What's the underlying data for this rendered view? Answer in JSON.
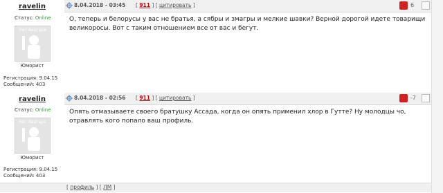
{
  "posts": [
    {
      "username": "ravelin",
      "status_label": "Статус:",
      "status_value": "Online",
      "avatar_text": "Нет Аватара",
      "rank": "Юморист",
      "registration": "Регистрация: 9.04.15",
      "messages": "Сообщений: 403",
      "date": "8.04.2018 - 03:45",
      "post_number": "911",
      "quote_label": "цитировать",
      "rating": "6",
      "text": "О, теперь и белорусы у вас не братья, а сябры и змагры и мелкие шавки? Верной дорогой идете товарищи великоросы. Вот с таким отношением все от вас и бегут."
    },
    {
      "username": "ravelin",
      "status_label": "Статус:",
      "status_value": "Online",
      "avatar_text": "Нет Аватара",
      "rank": "Юморист",
      "registration": "Регистрация: 9.04.15",
      "messages": "Сообщений: 403",
      "date": "8.04.2018 - 02:56",
      "post_number": "911",
      "quote_label": "цитировать",
      "rating": "-7",
      "text": "Опять отмазываете своего братушку Ассада, когда он опять применил хлор в Гутте? Ну молодцы чо, отравлять кого попало ваш профиль."
    }
  ],
  "footer": {
    "profile_label": "профиль",
    "pm_label": "ЛМ"
  },
  "colors": {
    "online": "#2aa42a",
    "post_number": "#cc0000",
    "rating_icon": "#d21f1f"
  }
}
